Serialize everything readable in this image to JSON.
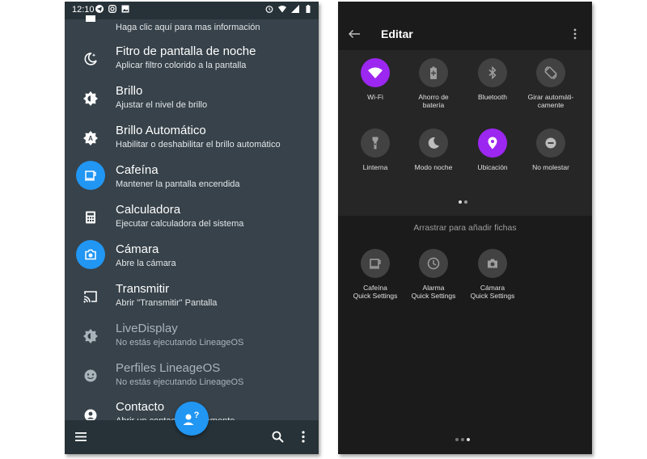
{
  "left_screen": {
    "status_bar": {
      "time": "12:10"
    },
    "partial_item_text": "Haga clic aquí para mas información",
    "items": [
      {
        "title": "Fitro de pantalla de noche",
        "subtitle": "Aplicar filtro colorido a la pantalla",
        "icon": "night-mode-icon"
      },
      {
        "title": "Brillo",
        "subtitle": "Ajustar el nivel de brillo",
        "icon": "brightness-icon"
      },
      {
        "title": "Brillo Automático",
        "subtitle": "Habilitar o deshabilitar el brillo automático",
        "icon": "auto-brightness-icon"
      },
      {
        "title": "Cafeína",
        "subtitle": "Mantener la pantalla encendida",
        "icon": "coffee-icon",
        "active": true
      },
      {
        "title": "Calculadora",
        "subtitle": "Ejecutar calculadora del sistema",
        "icon": "calculator-icon"
      },
      {
        "title": "Cámara",
        "subtitle": "Abre la cámara",
        "icon": "camera-icon",
        "active": true
      },
      {
        "title": "Transmitir",
        "subtitle": "Abrir \"Transmitir\" Pantalla",
        "icon": "cast-icon"
      },
      {
        "title": "LiveDisplay",
        "subtitle": "No estás ejecutando LineageOS",
        "icon": "livedisplay-icon",
        "disabled": true
      },
      {
        "title": "Perfiles LineageOS",
        "subtitle": "No estás ejecutando LineageOS",
        "icon": "profiles-icon",
        "disabled": true
      },
      {
        "title": "Contacto",
        "subtitle": "Abrir un contacto rápidamente",
        "icon": "contact-icon"
      }
    ],
    "accent_color": "#2196f3"
  },
  "right_screen": {
    "title": "Editar",
    "tiles": [
      {
        "label": "Wi-Fi",
        "icon": "wifi-icon",
        "on": true
      },
      {
        "label": "Ahorro de\nbatería",
        "icon": "battery-saver-icon",
        "on": false
      },
      {
        "label": "Bluetooth",
        "icon": "bluetooth-icon",
        "on": false
      },
      {
        "label": "Girar automáti-\ncamente",
        "icon": "auto-rotate-icon",
        "on": false
      },
      {
        "label": "Linterna",
        "icon": "flashlight-icon",
        "on": false
      },
      {
        "label": "Modo noche",
        "icon": "night-mode-icon",
        "on": false
      },
      {
        "label": "Ubicación",
        "icon": "location-icon",
        "on": true
      },
      {
        "label": "No molestar",
        "icon": "do-not-disturb-icon",
        "on": false
      }
    ],
    "drag_hint": "Arrastrar para añadir fichas",
    "available_tiles": [
      {
        "label": "Cafeína\nQuick Settings",
        "icon": "coffee-icon"
      },
      {
        "label": "Alarma\nQuick Settings",
        "icon": "alarm-icon"
      },
      {
        "label": "Cámara\nQuick Settings",
        "icon": "camera-icon"
      }
    ],
    "accent_color": "#9c27f0"
  }
}
